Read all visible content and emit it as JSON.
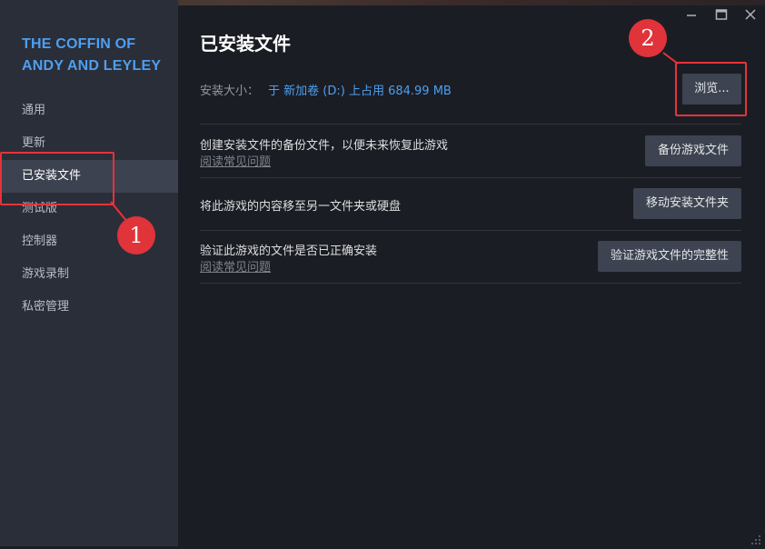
{
  "game": {
    "title": "THE COFFIN OF ANDY AND LEYLEY"
  },
  "sidebar": {
    "items": [
      {
        "label": "通用"
      },
      {
        "label": "更新"
      },
      {
        "label": "已安装文件",
        "active": true
      },
      {
        "label": "测试版"
      },
      {
        "label": "控制器"
      },
      {
        "label": "游戏录制"
      },
      {
        "label": "私密管理"
      }
    ]
  },
  "main": {
    "title": "已安装文件",
    "size_label": "安装大小：",
    "size_value": "于 新加卷 (D:) 上占用 684.99 MB",
    "browse_label": "浏览...",
    "options": [
      {
        "title": "创建安装文件的备份文件，以便未来恢复此游戏",
        "link": "阅读常见问题",
        "button": "备份游戏文件"
      },
      {
        "title": "将此游戏的内容移至另一文件夹或硬盘",
        "link": "",
        "button": "移动安装文件夹"
      },
      {
        "title": "验证此游戏的文件是否已正确安装",
        "link": "阅读常见问题",
        "button": "验证游戏文件的完整性"
      }
    ]
  },
  "annotations": {
    "marker_1": "1",
    "marker_2": "2"
  },
  "icons": {
    "minimize": "minimize-icon",
    "maximize": "maximize-icon",
    "close": "close-icon",
    "resize": "resize-grip-icon"
  },
  "colors": {
    "accent": "#4e9ff0",
    "annotation": "#e0333a",
    "sidebar_bg": "#2a2e38",
    "main_bg": "#1b1d24"
  }
}
